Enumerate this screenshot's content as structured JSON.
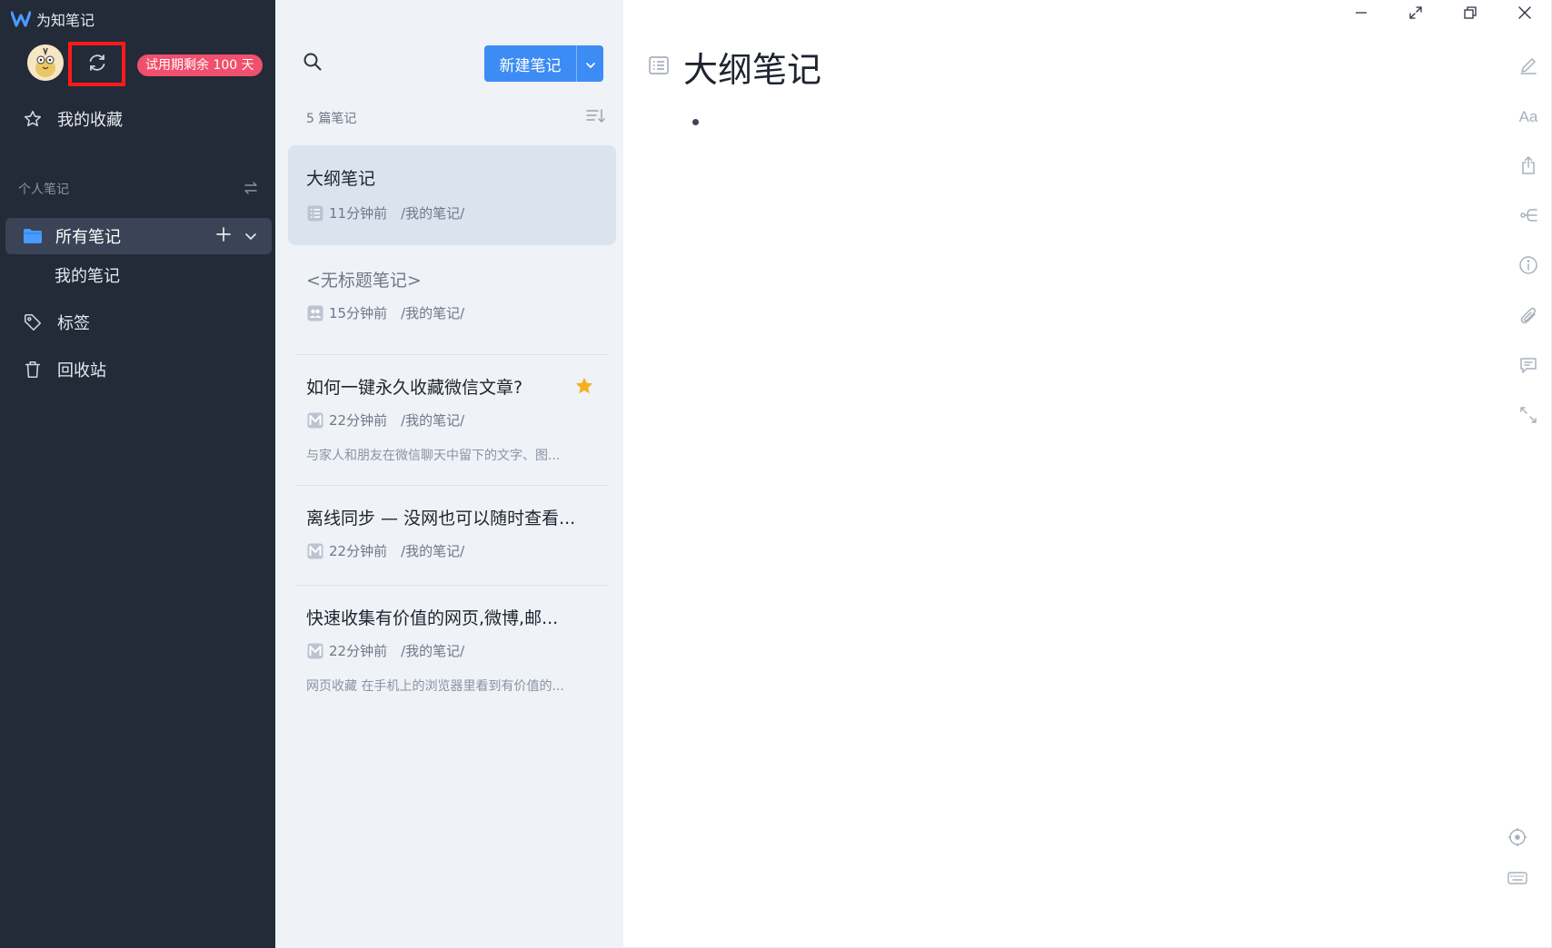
{
  "app": {
    "title": "为知笔记"
  },
  "account": {
    "trial_badge": "试用期剩余 100 天"
  },
  "sidebar": {
    "favorites": "我的收藏",
    "section_title": "个人笔记",
    "folder": "所有笔记",
    "sub_folder": "我的笔记",
    "tags": "标签",
    "trash": "回收站"
  },
  "notelist": {
    "new_note_label": "新建笔记",
    "count": "5 篇笔记",
    "notes": [
      {
        "title": "大纲笔记",
        "time": "11分钟前",
        "path": "/我的笔记/",
        "icon": "outline-icon",
        "selected": true
      },
      {
        "title": "<无标题笔记>",
        "time": "15分钟前",
        "path": "/我的笔记/",
        "icon": "collab-icon"
      },
      {
        "title": "如何一键永久收藏微信文章?",
        "time": "22分钟前",
        "path": "/我的笔记/",
        "icon": "markdown-icon",
        "starred": true,
        "snippet": "与家人和朋友在微信聊天中留下的文字、图..."
      },
      {
        "title": "离线同步 — 没网也可以随时查看...",
        "time": "22分钟前",
        "path": "/我的笔记/",
        "icon": "markdown-icon"
      },
      {
        "title": "快速收集有价值的网页,微博,邮...",
        "time": "22分钟前",
        "path": "/我的笔记/",
        "icon": "markdown-icon",
        "snippet": "网页收藏 在手机上的浏览器里看到有价值的..."
      }
    ]
  },
  "editor": {
    "title": "大纲笔记",
    "font_tool": "Aa"
  },
  "colors": {
    "sidebar": "#232a38",
    "accent": "#3d8cf5",
    "badge": "#f0506e",
    "star": "#f6b01b",
    "highlight": "#ff1a1a"
  }
}
